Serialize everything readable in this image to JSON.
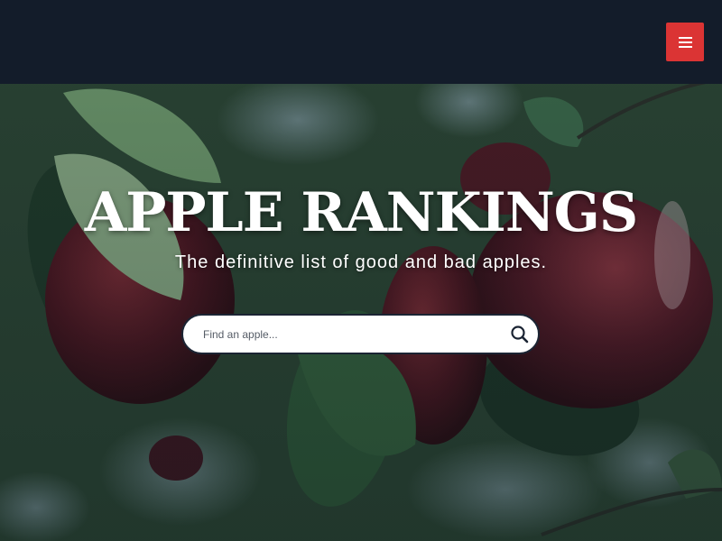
{
  "header": {
    "menu_icon": "hamburger-menu-icon",
    "menu_button_color": "#db3434",
    "background": "#131c2a"
  },
  "hero": {
    "title": "APPLE RANKINGS",
    "tagline": "The definitive list of good and bad apples.",
    "background_image": "apples-on-tree-photo"
  },
  "search": {
    "placeholder": "Find an apple...",
    "value": "",
    "icon": "search-icon"
  }
}
